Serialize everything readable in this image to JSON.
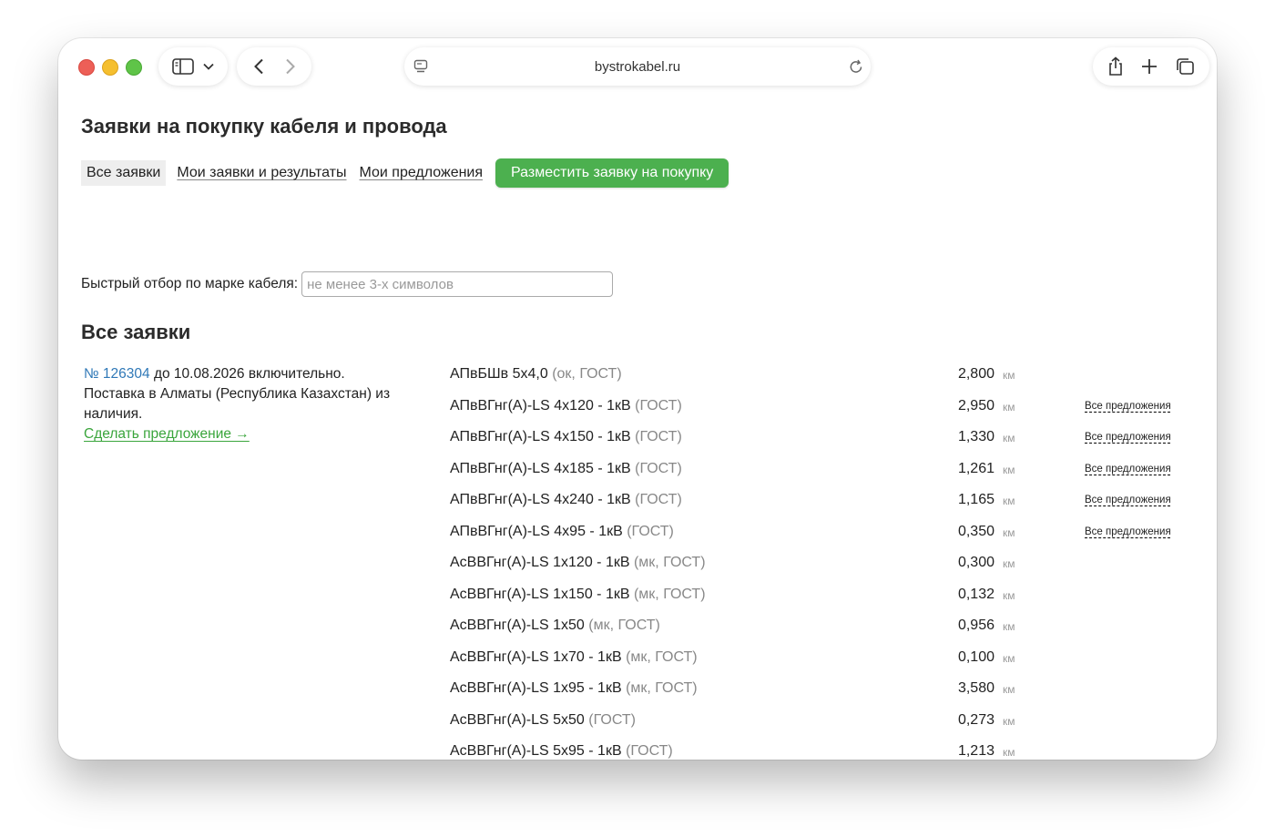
{
  "browser": {
    "url": "bystrokabel.ru"
  },
  "page": {
    "title": "Заявки на покупку кабеля и провода",
    "tabs": [
      {
        "label": "Все заявки"
      },
      {
        "label": "Мои заявки и результаты"
      },
      {
        "label": "Мои предложения"
      }
    ],
    "place_order_label": "Разместить заявку на покупку",
    "filter": {
      "label": "Быстрый отбор по марке кабеля:",
      "placeholder": "не менее 3-х символов",
      "value": ""
    },
    "section_title": "Все заявки"
  },
  "order": {
    "number": "№ 126304",
    "deadline": " до 10.08.2026 включительно.",
    "delivery": "Поставка в Алматы (Республика Казахстан) из наличия.",
    "make_offer_label": "Сделать предложение →",
    "items": [
      {
        "name": "АПвБШв 5х4,0",
        "note": "(ок, ГОСТ)",
        "qty": "2,800",
        "unit": "км",
        "offers": ""
      },
      {
        "name": "АПвВГнг(А)-LS 4х120 - 1кВ",
        "note": "(ГОСТ)",
        "qty": "2,950",
        "unit": "км",
        "offers": "Все предложения"
      },
      {
        "name": "АПвВГнг(А)-LS 4х150 - 1кВ",
        "note": "(ГОСТ)",
        "qty": "1,330",
        "unit": "км",
        "offers": "Все предложения"
      },
      {
        "name": "АПвВГнг(А)-LS 4х185 - 1кВ",
        "note": "(ГОСТ)",
        "qty": "1,261",
        "unit": "км",
        "offers": "Все предложения"
      },
      {
        "name": "АПвВГнг(А)-LS 4х240 - 1кВ",
        "note": "(ГОСТ)",
        "qty": "1,165",
        "unit": "км",
        "offers": "Все предложения"
      },
      {
        "name": "АПвВГнг(А)-LS 4х95 - 1кВ",
        "note": "(ГОСТ)",
        "qty": "0,350",
        "unit": "км",
        "offers": "Все предложения"
      },
      {
        "name": "АсВВГнг(А)-LS 1х120 - 1кВ",
        "note": "(мк, ГОСТ)",
        "qty": "0,300",
        "unit": "км",
        "offers": ""
      },
      {
        "name": "АсВВГнг(А)-LS 1х150 - 1кВ",
        "note": "(мк, ГОСТ)",
        "qty": "0,132",
        "unit": "км",
        "offers": ""
      },
      {
        "name": "АсВВГнг(А)-LS 1х50",
        "note": "(мк, ГОСТ)",
        "qty": "0,956",
        "unit": "км",
        "offers": ""
      },
      {
        "name": "АсВВГнг(А)-LS 1х70 - 1кВ",
        "note": "(мк, ГОСТ)",
        "qty": "0,100",
        "unit": "км",
        "offers": ""
      },
      {
        "name": "АсВВГнг(А)-LS 1х95 - 1кВ",
        "note": "(мк, ГОСТ)",
        "qty": "3,580",
        "unit": "км",
        "offers": ""
      },
      {
        "name": "АсВВГнг(А)-LS 5х50",
        "note": "(ГОСТ)",
        "qty": "0,273",
        "unit": "км",
        "offers": ""
      },
      {
        "name": "АсВВГнг(А)-LS 5х95 - 1кВ",
        "note": "(ГОСТ)",
        "qty": "1,213",
        "unit": "км",
        "offers": ""
      }
    ]
  }
}
